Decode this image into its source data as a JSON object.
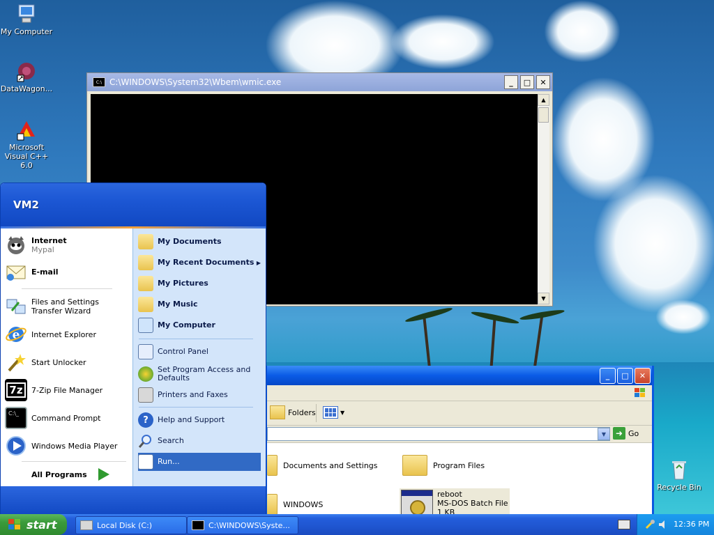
{
  "desktop": {
    "icons": [
      {
        "label": "My Computer",
        "icon": "my-computer-icon"
      },
      {
        "label": "DataWagon...",
        "icon": "datawagon-icon"
      },
      {
        "label": "Microsoft Visual C++ 6.0",
        "icon": "visual-cpp-icon"
      },
      {
        "label": "Recycle Bin",
        "icon": "recycle-bin-icon"
      }
    ]
  },
  "console": {
    "title": "C:\\WINDOWS\\System32\\Wbem\\wmic.exe",
    "minimize": "_",
    "maximize": "□",
    "close": "✕"
  },
  "explorer": {
    "toolbar": {
      "folders_label": "Folders"
    },
    "address": {
      "go_label": "Go"
    },
    "files": [
      {
        "name": "Documents and Settings",
        "type": "folder"
      },
      {
        "name": "Program Files",
        "type": "folder"
      },
      {
        "name": "WINDOWS",
        "type": "folder"
      },
      {
        "name": "reboot",
        "type_label": "MS-DOS Batch File",
        "size": "1 KB"
      }
    ]
  },
  "start_menu": {
    "user": "VM2",
    "pinned": [
      {
        "title": "Internet",
        "subtitle": "Mypal",
        "icon": "mypal-icon"
      },
      {
        "title": "E-mail",
        "subtitle": "",
        "icon": "email-icon"
      }
    ],
    "recent": [
      {
        "title": "Files and Settings Transfer Wizard",
        "icon": "transfer-wizard-icon"
      },
      {
        "title": "Internet Explorer",
        "icon": "internet-explorer-icon"
      },
      {
        "title": "Start Unlocker",
        "icon": "unlocker-icon"
      },
      {
        "title": "7-Zip File Manager",
        "icon": "7zip-icon"
      },
      {
        "title": "Command Prompt",
        "icon": "command-prompt-icon"
      },
      {
        "title": "Windows Media Player",
        "icon": "media-player-icon"
      }
    ],
    "all_programs": "All Programs",
    "right": {
      "places": [
        "My Documents",
        "My Recent Documents",
        "My Pictures",
        "My Music",
        "My Computer"
      ],
      "system": [
        "Control Panel",
        "Set Program Access and Defaults",
        "Printers and Faxes"
      ],
      "tools": [
        "Help and Support",
        "Search",
        "Run..."
      ]
    }
  },
  "taskbar": {
    "start_label": "start",
    "buttons": [
      {
        "label": "Local Disk (C:)"
      },
      {
        "label": "C:\\WINDOWS\\Syste..."
      }
    ],
    "clock": "12:36 PM"
  }
}
